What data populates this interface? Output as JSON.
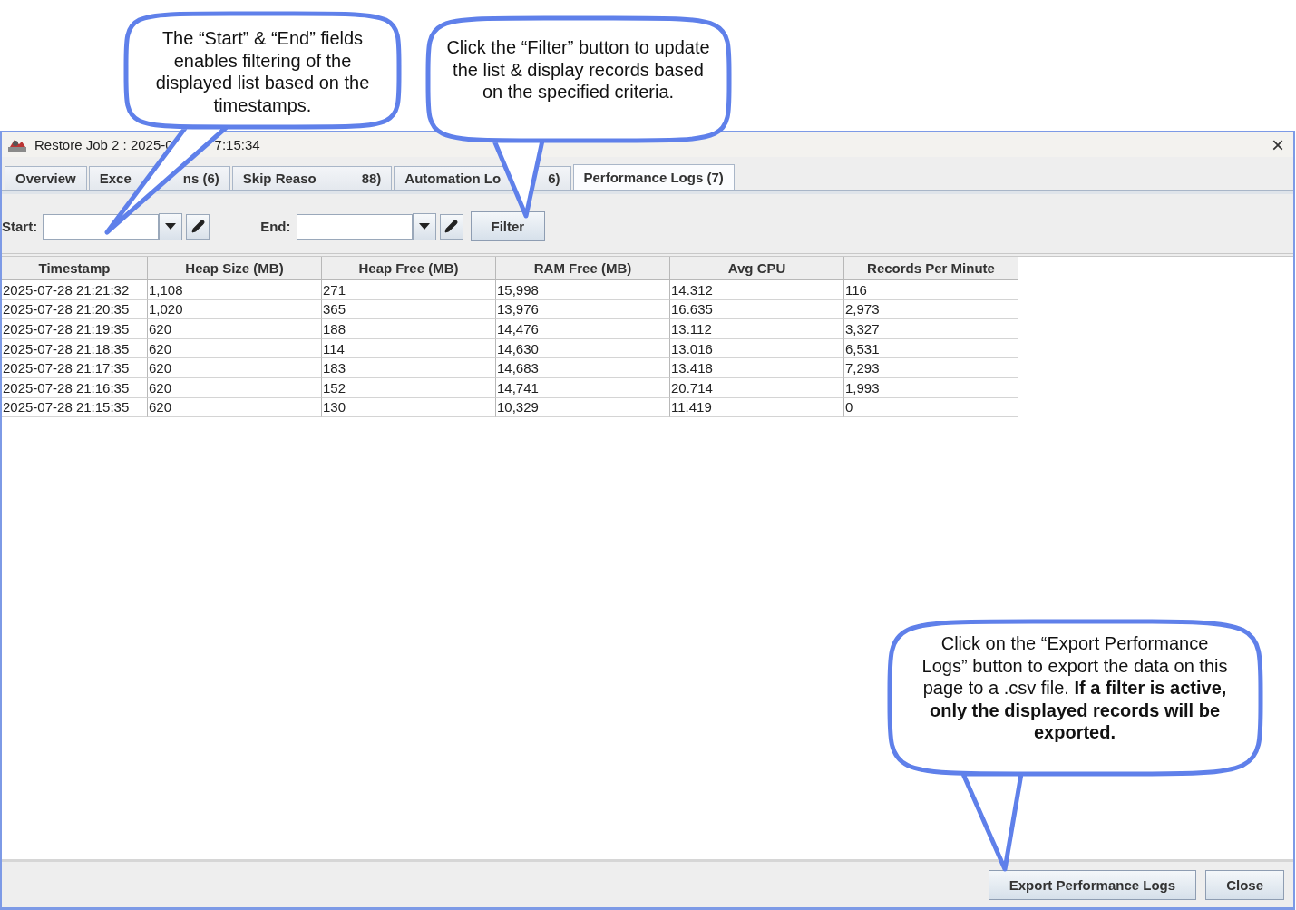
{
  "callouts": [
    {
      "text": "The “Start” & “End” fields enables filtering of the displayed list based on the timestamps."
    },
    {
      "text": "Click the “Filter” button to update the list & display records based on the specified criteria."
    },
    {
      "text": "Click on the “Export Performance Logs” button to export the data on this page to a .csv file. **If a filter is active, only the displayed records will be exported.**"
    }
  ],
  "window": {
    "title_parts": [
      "Restore Job 2 : 2025-0",
      "7:15:34"
    ],
    "close": "×"
  },
  "tabs": [
    {
      "label_parts": [
        "Overview"
      ],
      "selected": false
    },
    {
      "label_parts": [
        "Exce",
        "ns (6)"
      ],
      "selected": false
    },
    {
      "label_parts": [
        "Skip Reaso",
        "88)"
      ],
      "selected": false
    },
    {
      "label_parts": [
        "Automation Lo",
        "6)"
      ],
      "selected": false
    },
    {
      "label_parts": [
        "Performance Logs (7)"
      ],
      "selected": true
    }
  ],
  "filter": {
    "start_label": "Start:",
    "end_label": "End:",
    "button": "Filter"
  },
  "table": {
    "columns": [
      "Timestamp",
      "Heap Size (MB)",
      "Heap Free (MB)",
      "RAM Free (MB)",
      "Avg CPU",
      "Records Per Minute"
    ],
    "rows": [
      [
        "2025-07-28 21:21:32",
        "1,108",
        "271",
        "15,998",
        "14.312",
        "116"
      ],
      [
        "2025-07-28 21:20:35",
        "1,020",
        "365",
        "13,976",
        "16.635",
        "2,973"
      ],
      [
        "2025-07-28 21:19:35",
        "620",
        "188",
        "14,476",
        "13.112",
        "3,327"
      ],
      [
        "2025-07-28 21:18:35",
        "620",
        "114",
        "14,630",
        "13.016",
        "6,531"
      ],
      [
        "2025-07-28 21:17:35",
        "620",
        "183",
        "14,683",
        "13.418",
        "7,293"
      ],
      [
        "2025-07-28 21:16:35",
        "620",
        "152",
        "14,741",
        "20.714",
        "1,993"
      ],
      [
        "2025-07-28 21:15:35",
        "620",
        "130",
        "10,329",
        "11.419",
        "0"
      ]
    ]
  },
  "buttons": [
    "Export Performance Logs",
    "Close"
  ]
}
